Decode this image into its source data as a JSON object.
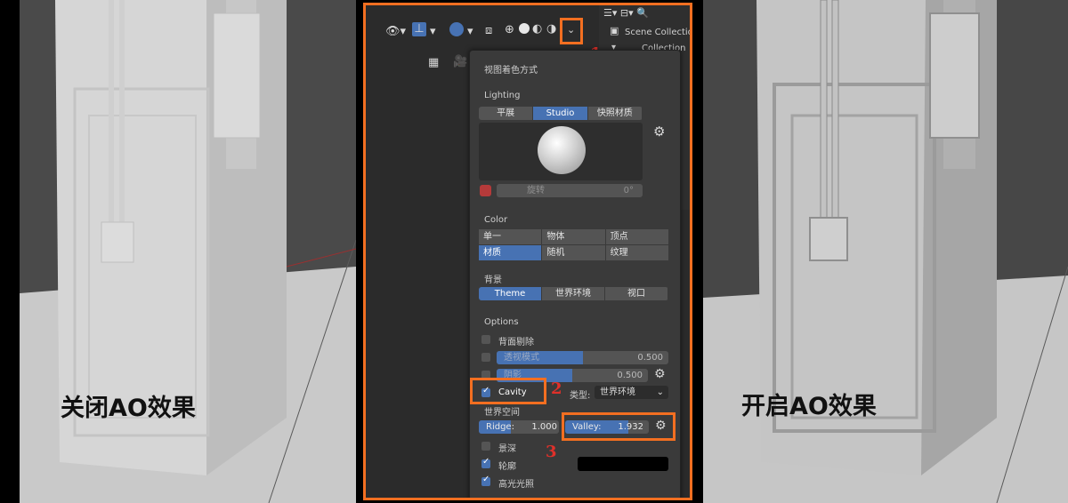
{
  "captions": {
    "left": "关闭AO效果",
    "right": "开启AO效果"
  },
  "header": {
    "outliner_scene": "Scene Collection",
    "outliner_collection": "Collection"
  },
  "popup": {
    "title": "视图着色方式",
    "lighting": {
      "label": "Lighting",
      "modes": [
        "平展",
        "Studio",
        "快照材质"
      ],
      "rotation_label": "旋转",
      "rotation_value": "0°"
    },
    "color": {
      "label": "Color",
      "options": [
        "单一",
        "物体",
        "顶点",
        "材质",
        "随机",
        "纹理"
      ]
    },
    "background": {
      "label": "背景",
      "options": [
        "Theme",
        "世界环境",
        "视口"
      ]
    },
    "options": {
      "label": "Options",
      "backface": "背面剔除",
      "xray_label": "透视模式",
      "xray_value": "0.500",
      "xray_fraction": 0.5,
      "shadow_label": "阴影",
      "shadow_value": "0.500",
      "shadow_fraction": 0.5,
      "cavity_label": "Cavity",
      "type_label": "类型:",
      "type_value": "世界环境",
      "space_label": "世界空间",
      "ridge_label": "Ridge:",
      "ridge_value": "1.000",
      "valley_label": "Valley:",
      "valley_value": "1.932",
      "dof_label": "景深",
      "outline_label": "轮廓",
      "specular_label": "高光光照"
    }
  },
  "annotations": {
    "a1": "1",
    "a2": "2",
    "a3": "3"
  },
  "colors": {
    "accent": "#4772b3",
    "highlight": "#f36f21",
    "annotation": "#e0302a"
  }
}
